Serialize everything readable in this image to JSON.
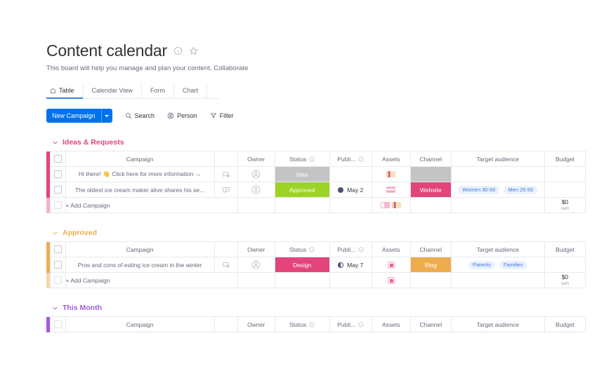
{
  "header": {
    "title": "Content calendar",
    "subtitle": "This board will help you manage and plan your content. Collaborate",
    "info_icon": "info-circle-icon",
    "star_icon": "star-icon"
  },
  "tabs": [
    {
      "label": "Table",
      "icon": "home-icon",
      "active": true
    },
    {
      "label": "Calendar View",
      "icon": "",
      "active": false
    },
    {
      "label": "Form",
      "icon": "",
      "active": false
    },
    {
      "label": "Chart",
      "icon": "",
      "active": false
    }
  ],
  "toolbar": {
    "new_campaign_label": "New Campaign",
    "new_campaign_color": "#0073ea",
    "dropdown_icon": "chevron-down-icon",
    "items": [
      {
        "label": "Search",
        "icon": "search-icon"
      },
      {
        "label": "Person",
        "icon": "person-icon"
      },
      {
        "label": "Filter",
        "icon": "filter-icon"
      }
    ]
  },
  "columns": {
    "campaign": "Campaign",
    "owner": "Owner",
    "status": "Status",
    "publish": "Publi...",
    "assets": "Assets",
    "channel": "Channel",
    "audience": "Target audience",
    "budget": "Budget"
  },
  "add_row_label": "+ Add Campaign",
  "sum": {
    "value": "$0",
    "label": "sum"
  },
  "groups": [
    {
      "name": "Ideas & Requests",
      "color": "#e2447b",
      "rows": [
        {
          "campaign": "Hi there! 👋 Click here for more information →",
          "bubble": "comment-badge-icon",
          "status": {
            "label": "Idea",
            "color": "#c4c4c4"
          },
          "date": {
            "label": "",
            "dot": "none"
          },
          "assets": [
            "t-orange"
          ],
          "channel": {
            "label": "",
            "color": "#c4c4c4"
          },
          "audience": []
        },
        {
          "campaign": "The oldest ice cream maker alive shares his se...",
          "bubble": "comment-add-icon",
          "status": {
            "label": "Approved",
            "color": "#9cd326"
          },
          "date": {
            "label": "May 2",
            "dot": "full"
          },
          "assets": [
            "t-pink"
          ],
          "channel": {
            "label": "Website",
            "color": "#e2447b"
          },
          "audience": [
            "Women 30-50",
            "Men 25-50"
          ]
        }
      ],
      "add_assets": [
        "t-white",
        "t-orange"
      ],
      "show_sum": true
    },
    {
      "name": "Approved",
      "color": "#f0ad4e",
      "rows": [
        {
          "campaign": "Pros and cons of eating ice cream in the winter",
          "bubble": "comment-badge-icon",
          "status": {
            "label": "Design",
            "color": "#e2447b"
          },
          "date": {
            "label": "May 7",
            "dot": "half"
          },
          "assets": [
            "t-sq"
          ],
          "channel": {
            "label": "Blog",
            "color": "#eeac4d"
          },
          "audience": [
            "Parents",
            "Families"
          ]
        }
      ],
      "add_assets": [
        "t-sq"
      ],
      "show_sum": true
    },
    {
      "name": "This Month",
      "color": "#a25ddc",
      "rows": [],
      "add_assets": [],
      "show_sum": false,
      "header_only": true
    }
  ]
}
